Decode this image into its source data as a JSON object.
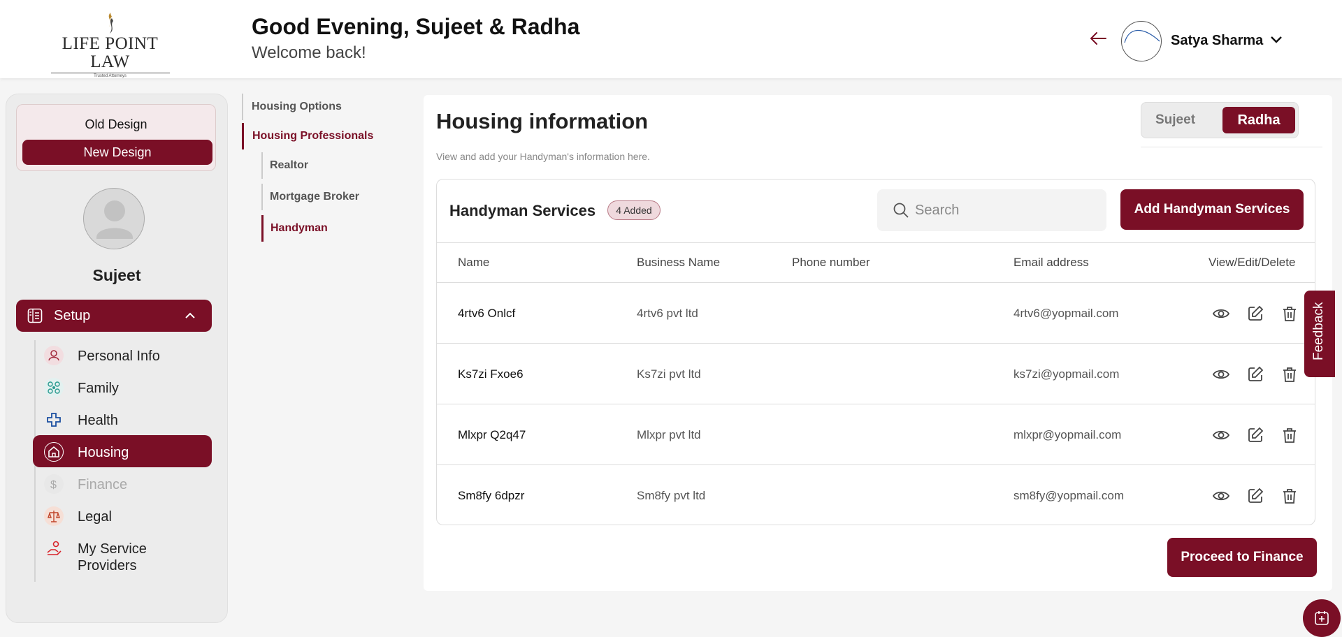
{
  "header": {
    "logo_text": "LIFE POINT LAW",
    "logo_tagline": "Trusted Attorneys",
    "greeting": "Good Evening, Sujeet & Radha",
    "welcome": "Welcome back!",
    "user_name": "Satya Sharma"
  },
  "sidebar": {
    "old_design": "Old Design",
    "new_design": "New Design",
    "profile_name": "Sujeet",
    "setup_label": "Setup",
    "items": [
      {
        "label": "Personal Info",
        "icon": "person-icon"
      },
      {
        "label": "Family",
        "icon": "family-icon"
      },
      {
        "label": "Health",
        "icon": "health-cross-icon"
      },
      {
        "label": "Housing",
        "icon": "house-icon",
        "active": true
      },
      {
        "label": "Finance",
        "icon": "dollar-icon",
        "disabled": true
      },
      {
        "label": "Legal",
        "icon": "scales-icon"
      },
      {
        "label_line1": "My Service",
        "label_line2": "Providers",
        "icon": "service-provider-icon"
      }
    ]
  },
  "subnav": {
    "housing_options": "Housing Options",
    "housing_professionals": "Housing Professionals",
    "realtor": "Realtor",
    "mortgage_broker": "Mortgage Broker",
    "handyman": "Handyman"
  },
  "main": {
    "title": "Housing information",
    "subtitle": "View and add your Handyman's information here.",
    "toggle": {
      "option1": "Sujeet",
      "option2": "Radha",
      "selected": "Radha"
    },
    "card_title": "Handyman Services",
    "added_badge": "4 Added",
    "search_placeholder": "Search",
    "add_button": "Add Handyman Services",
    "columns": {
      "name": "Name",
      "business": "Business Name",
      "phone": "Phone number",
      "email": "Email address",
      "actions": "View/Edit/Delete"
    },
    "rows": [
      {
        "name": "4rtv6 Onlcf",
        "business": "4rtv6 pvt ltd",
        "phone": "",
        "email": "4rtv6@yopmail.com"
      },
      {
        "name": "Ks7zi Fxoe6",
        "business": "Ks7zi pvt ltd",
        "phone": "",
        "email": "ks7zi@yopmail.com"
      },
      {
        "name": "Mlxpr Q2q47",
        "business": "Mlxpr pvt ltd",
        "phone": "",
        "email": "mlxpr@yopmail.com"
      },
      {
        "name": "Sm8fy 6dpzr",
        "business": "Sm8fy pvt ltd",
        "phone": "",
        "email": "sm8fy@yopmail.com"
      }
    ],
    "proceed_button": "Proceed to Finance"
  },
  "feedback_label": "Feedback",
  "colors": {
    "brand": "#7a0f26",
    "background": "#f5f5f5"
  }
}
